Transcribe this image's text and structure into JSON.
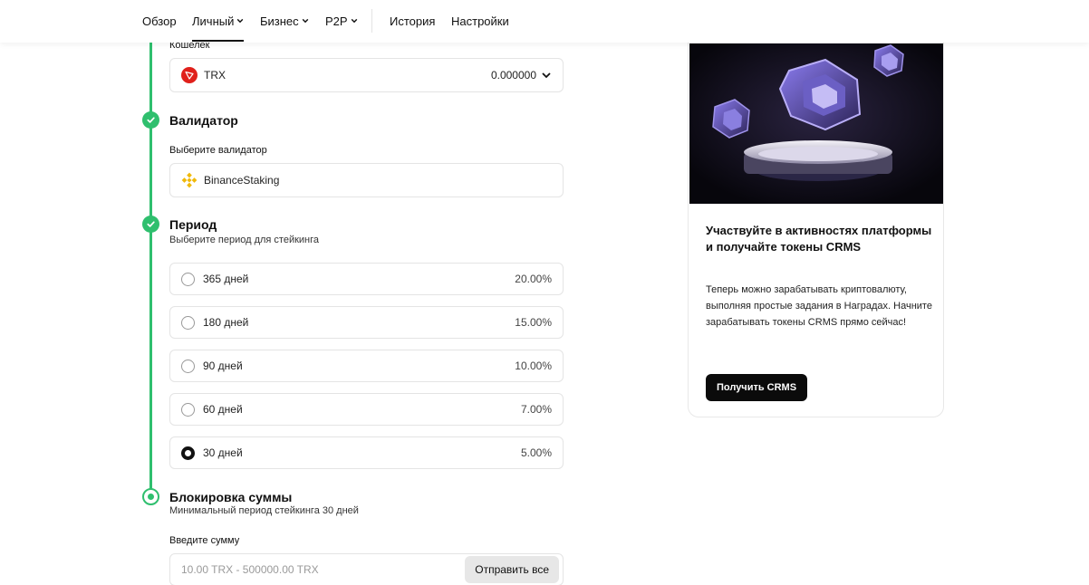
{
  "nav": {
    "items": [
      {
        "label": "Обзор",
        "has_dropdown": false,
        "active": false
      },
      {
        "label": "Личный",
        "has_dropdown": true,
        "active": true
      },
      {
        "label": "Бизнес",
        "has_dropdown": true,
        "active": false
      },
      {
        "label": "P2P",
        "has_dropdown": true,
        "active": false
      },
      {
        "label": "История",
        "has_dropdown": false,
        "active": false
      },
      {
        "label": "Настройки",
        "has_dropdown": false,
        "active": false
      }
    ]
  },
  "wallet": {
    "label": "Кошелек",
    "coin": "TRX",
    "amount": "0.000000"
  },
  "validator": {
    "title": "Валидатор",
    "label": "Выберите валидатор",
    "value": "BinanceStaking"
  },
  "period": {
    "title": "Период",
    "subtitle": "Выберите период для стейкинга",
    "options": [
      {
        "label": "365 дней",
        "rate": "20.00%",
        "selected": false
      },
      {
        "label": "180 дней",
        "rate": "15.00%",
        "selected": false
      },
      {
        "label": "90 дней",
        "rate": "10.00%",
        "selected": false
      },
      {
        "label": "60 дней",
        "rate": "7.00%",
        "selected": false
      },
      {
        "label": "30 дней",
        "rate": "5.00%",
        "selected": true
      }
    ]
  },
  "lock": {
    "title": "Блокировка суммы",
    "subtitle": "Минимальный период стейкинга 30 дней",
    "input_label": "Введите сумму",
    "placeholder": "10.00 TRX - 500000.00 TRX",
    "send_all": "Отправить все"
  },
  "promo": {
    "title": "Участвуйте в активностях платформы и получайте токены CRMS",
    "text": "Теперь можно зарабатывать криптовалюту, выполняя простые задания в Наградах. Начните зарабатывать токены CRMS прямо сейчас!",
    "button": "Получить CRMS"
  },
  "colors": {
    "step_green": "#2fbf6e",
    "trx_red": "#e0201b",
    "binance_yellow": "#f0b90b",
    "button_dark": "#0b0b0b"
  },
  "icons": {
    "chevron": "chevron-down-icon",
    "check": "check-icon",
    "trx": "trx-coin-icon",
    "binance": "binance-icon"
  }
}
